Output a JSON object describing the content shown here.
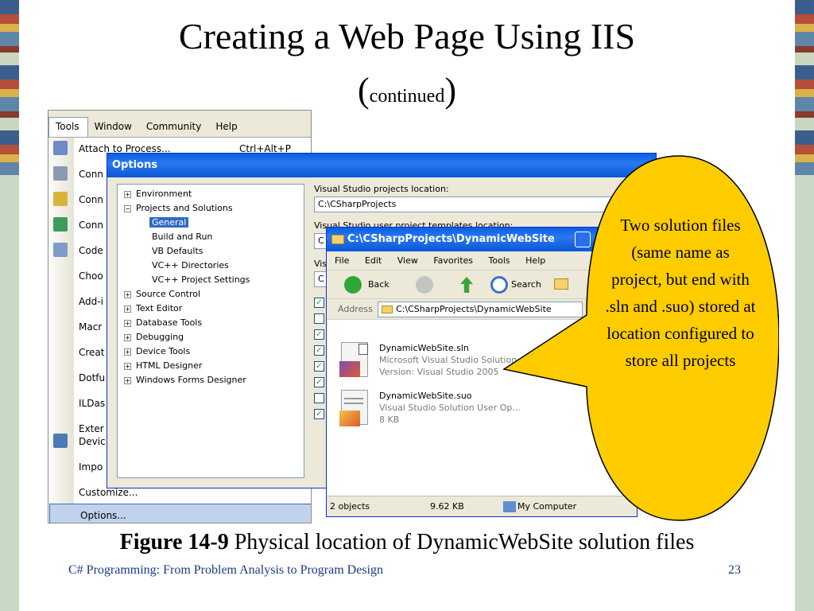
{
  "slide": {
    "title": "Creating a Web Page Using IIS",
    "subtitle_open": "(",
    "subtitle_word": "continued",
    "subtitle_close": ")",
    "caption_bold": "Figure 14-9",
    "caption_text": " Physical location of DynamicWebSite solution files",
    "footer": "C# Programming: From Problem Analysis to Program Design",
    "page_number": "23",
    "callout": "Two solution files (same name as project, but end with .sln and .suo) stored at location configured to store all projects"
  },
  "tools_menu": {
    "menubar": [
      "Tools",
      "Window",
      "Community",
      "Help"
    ],
    "items": [
      "Attach to Process...",
      "Conn",
      "Conn",
      "Conn",
      "Code",
      "Choo",
      "Add-i",
      "Macr",
      "Creat",
      "Dotfu",
      "ILDas",
      "Exter",
      "Devic",
      "Impo",
      "Customize...",
      "Options..."
    ],
    "shortcut": "Ctrl+Alt+P"
  },
  "options_dialog": {
    "title": "Options",
    "tree": [
      "Environment",
      "Projects and Solutions",
      "General",
      "Build and Run",
      "VB Defaults",
      "VC++ Directories",
      "VC++ Project Settings",
      "Source Control",
      "Text Editor",
      "Database Tools",
      "Debugging",
      "Device Tools",
      "HTML Designer",
      "Windows Forms Designer"
    ],
    "label_projects_location": "Visual Studio projects location:",
    "value_projects_location": "C:\\CSharpProjects",
    "label_templates_location": "Visual Studio user project templates location:",
    "value_partial_1": "C",
    "label_partial": "Visi",
    "value_partial_2": "C"
  },
  "explorer": {
    "title": "C:\\CSharpProjects\\DynamicWebSite",
    "menu": [
      "File",
      "Edit",
      "View",
      "Favorites",
      "Tools",
      "Help"
    ],
    "back": "Back",
    "search": "Search",
    "address_label": "Address",
    "address_value": "C:\\CSharpProjects\\DynamicWebSite",
    "files": [
      {
        "name": "DynamicWebSite.sln",
        "line2": "Microsoft Visual Studio Solution",
        "line3": "Version: Visual Studio 2005"
      },
      {
        "name": "DynamicWebSite.suo",
        "line2": "Visual Studio Solution User Op...",
        "line3": "8 KB"
      }
    ],
    "status_objects": "2 objects",
    "status_size": "9.62 KB",
    "status_location": "My Computer"
  }
}
